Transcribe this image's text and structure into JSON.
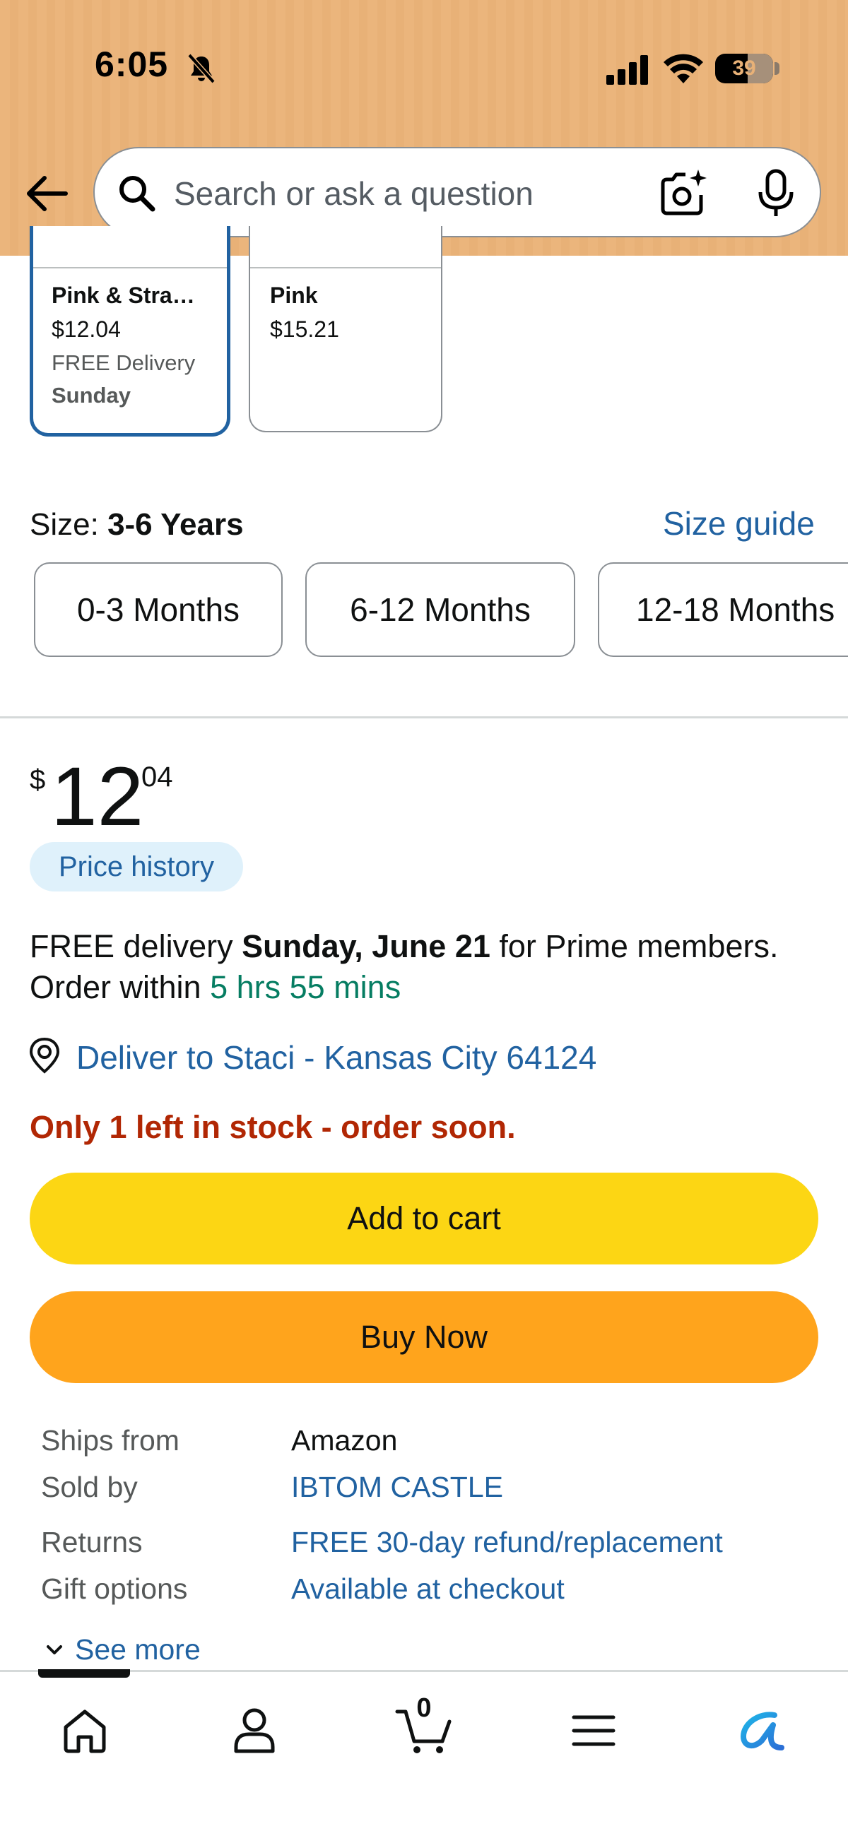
{
  "status_bar": {
    "time": "6:05",
    "battery": "39"
  },
  "header": {
    "search_placeholder": "Search or ask a question"
  },
  "variants": [
    {
      "name": "Pink & Stra…",
      "price": "$12.04",
      "delivery": "FREE Delivery",
      "day": "Sunday",
      "selected": true
    },
    {
      "name": "Pink",
      "price": "$15.21",
      "selected": false
    }
  ],
  "size": {
    "label": "Size:",
    "selected": "3-6 Years",
    "guide_label": "Size guide",
    "options": [
      "0-3 Months",
      "6-12 Months",
      "12-18 Months"
    ]
  },
  "price": {
    "currency": "$",
    "whole": "12",
    "fraction": "04",
    "history_label": "Price history"
  },
  "delivery": {
    "prefix": "FREE delivery ",
    "date": "Sunday, June 21",
    "suffix": " for Prime members.",
    "order_prefix": "Order within ",
    "countdown": "5 hrs 55 mins",
    "deliver_to": "Deliver to Staci - Kansas City 64124"
  },
  "stock_message": "Only 1 left in stock - order soon.",
  "buttons": {
    "add_to_cart": "Add to cart",
    "buy_now": "Buy Now"
  },
  "details": [
    {
      "label": "Ships from",
      "value": "Amazon"
    },
    {
      "label": "Sold by",
      "value": "IBTOM CASTLE"
    },
    {
      "label": "Returns",
      "value": "FREE 30-day refund/replacement"
    },
    {
      "label": "Gift options",
      "value": "Available at checkout"
    }
  ],
  "see_more": "See more",
  "bottom_nav": {
    "cart_count": "0",
    "icons": [
      "home-icon",
      "account-icon",
      "cart-icon",
      "menu-icon",
      "rufus-ai-icon"
    ]
  },
  "colors": {
    "header_bg": "#ebb57c",
    "link": "#2162a1",
    "add_to_cart": "#fcd614",
    "buy_now": "#ffa41c",
    "stock_alert": "#b12704",
    "countdown": "#067d62"
  }
}
